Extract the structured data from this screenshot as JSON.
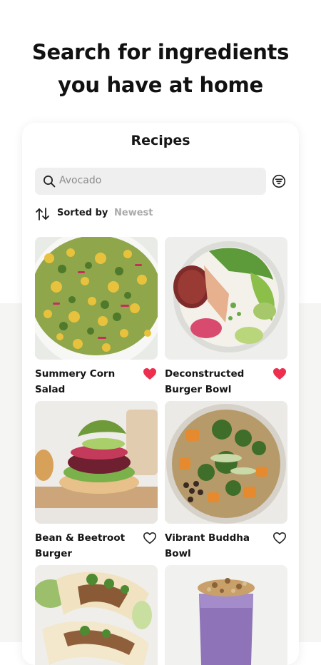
{
  "headline": {
    "line1": "Search for ingredients",
    "line2": "you have at home"
  },
  "card": {
    "title": "Recipes",
    "search": {
      "value": "Avocado",
      "icon": "search-icon"
    },
    "filter": {
      "icon": "filter-icon"
    },
    "sort": {
      "label": "Sorted by",
      "value": "Newest",
      "icon": "sort-arrows-icon"
    }
  },
  "recipes": [
    {
      "title_line1": "Summery Corn",
      "title_line2": "Salad",
      "favorited": true
    },
    {
      "title_line1": "Deconstructed",
      "title_line2": "Burger Bowl",
      "favorited": true
    },
    {
      "title_line1": "Bean & Beetroot",
      "title_line2": "Burger",
      "favorited": false
    },
    {
      "title_line1": "Vibrant Buddha",
      "title_line2": "Bowl",
      "favorited": false
    },
    {
      "title_line1": "",
      "title_line2": "",
      "favorited": false
    },
    {
      "title_line1": "",
      "title_line2": "",
      "favorited": false
    }
  ],
  "colors": {
    "heart_filled": "#ee2e4e",
    "heart_outline": "#222222",
    "search_bg": "#efefef",
    "muted_text": "#a9a9a9"
  }
}
